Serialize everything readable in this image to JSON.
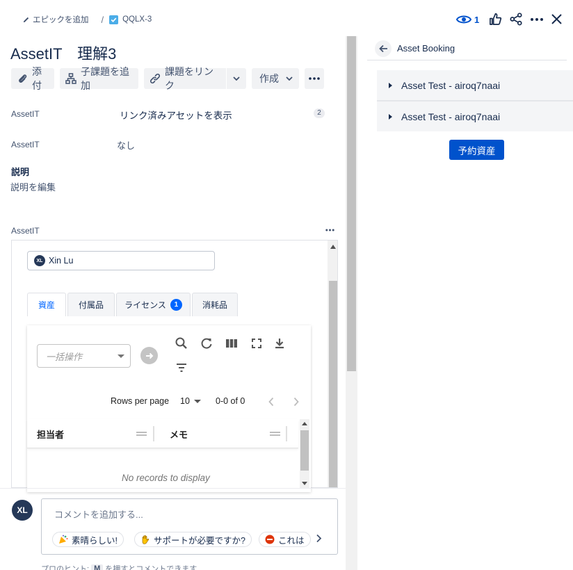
{
  "breadcrumb": {
    "add_epic": "エピックを追加",
    "separator": "/",
    "issue_key": "QQLX-3"
  },
  "header": {
    "watch_count": "1"
  },
  "title": "AssetIT　理解3",
  "toolbar": {
    "attach": "添付",
    "add_subtask": "子課題を追加",
    "link_issue": "課題をリンク",
    "create": "作成"
  },
  "fields": [
    {
      "label": "AssetIT",
      "value": "リンク済みアセットを表示",
      "badge": "2"
    },
    {
      "label": "AssetIT",
      "value": "なし"
    }
  ],
  "description": {
    "heading": "説明",
    "edit": "説明を編集"
  },
  "assetit_section": {
    "label": "AssetIT",
    "user": {
      "initials": "XL",
      "name": "Xin Lu"
    },
    "tabs": [
      {
        "label": "資産",
        "active": true
      },
      {
        "label": "付属品"
      },
      {
        "label": "ライセンス",
        "badge": "1"
      },
      {
        "label": "消耗品"
      }
    ],
    "bulk_placeholder": "一括操作",
    "pagination": {
      "rows_label": "Rows per page",
      "rows_value": "10",
      "range": "0-0 of 0"
    },
    "columns": [
      "担当者",
      "メモ"
    ],
    "empty": "No records to display"
  },
  "comment": {
    "avatar": "XL",
    "placeholder": "コメントを追加する...",
    "chips": [
      "素晴らしい!",
      "サポートが必要ですか?",
      "これは"
    ],
    "hint_prefix": "プロのヒント: ",
    "hint_key": "M",
    "hint_suffix": " を押すとコメントできます"
  },
  "panel": {
    "title": "Asset Booking",
    "items": [
      "Asset Test - airoq7naai",
      "Asset Test - airoq7naai"
    ],
    "reserve_button": "予約資産"
  },
  "colors": {
    "accent": "#0052cc",
    "link_blue": "#0065ff",
    "avatar": "#253858"
  }
}
